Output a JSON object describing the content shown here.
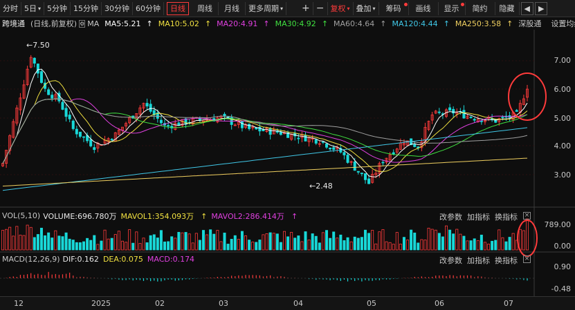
{
  "toolbar": {
    "periods": [
      "分时",
      "5日",
      "5分钟",
      "15分钟",
      "30分钟",
      "60分钟",
      "日线",
      "周线",
      "月线",
      "更多周期"
    ],
    "plus": "+",
    "minus": "−",
    "fuquan": "复权",
    "diejia": "叠加",
    "chouma": "筹码",
    "huaxian": "画线",
    "xianshi": "显示",
    "jianjie": "简约",
    "yincang": "隐藏"
  },
  "stock": {
    "name": "跨境通",
    "mode": "(日线,前复权)",
    "ma_label": "MA",
    "ma": [
      {
        "text": "MA5:5.21",
        "color": "#ffffff"
      },
      {
        "text": "MA10:5.02",
        "color": "#f0e040"
      },
      {
        "text": "MA20:4.91",
        "color": "#e040e0"
      },
      {
        "text": "MA30:4.92",
        "color": "#40e040"
      },
      {
        "text": "MA60:4.64",
        "color": "#a0a0a0"
      },
      {
        "text": "MA120:4.44",
        "color": "#40c8e8"
      },
      {
        "text": "MA250:3.58",
        "color": "#f0d060"
      }
    ],
    "index": "深股通",
    "settings": "设置均线"
  },
  "price_axis": [
    "7.00",
    "6.00",
    "5.00",
    "4.00",
    "3.00"
  ],
  "annotations": {
    "high": "7.50",
    "low": "2.48"
  },
  "vol": {
    "title": "VOL(5,10)",
    "volume": "VOLUME:696.780万",
    "mavol1": "MAVOL1:354.093万",
    "mavol2": "MAVOL2:286.414万",
    "axis_top": "789.00",
    "axis_bottom": "0.00"
  },
  "macd": {
    "title": "MACD(12,26,9)",
    "dif": "DIF:0.162",
    "dea": "DEA:0.075",
    "macd": "MACD:0.174",
    "axis_top": "0.90",
    "axis_bottom": "-0.48"
  },
  "panel_controls": {
    "change": "改参数",
    "add": "加指标",
    "swap": "换指标"
  },
  "x_axis": [
    "12",
    "2025",
    "02",
    "03",
    "04",
    "05",
    "06",
    "07"
  ],
  "colors": {
    "up": "#ff3b3b",
    "down": "#19d8d8",
    "accent": "#ff3b3b"
  }
}
